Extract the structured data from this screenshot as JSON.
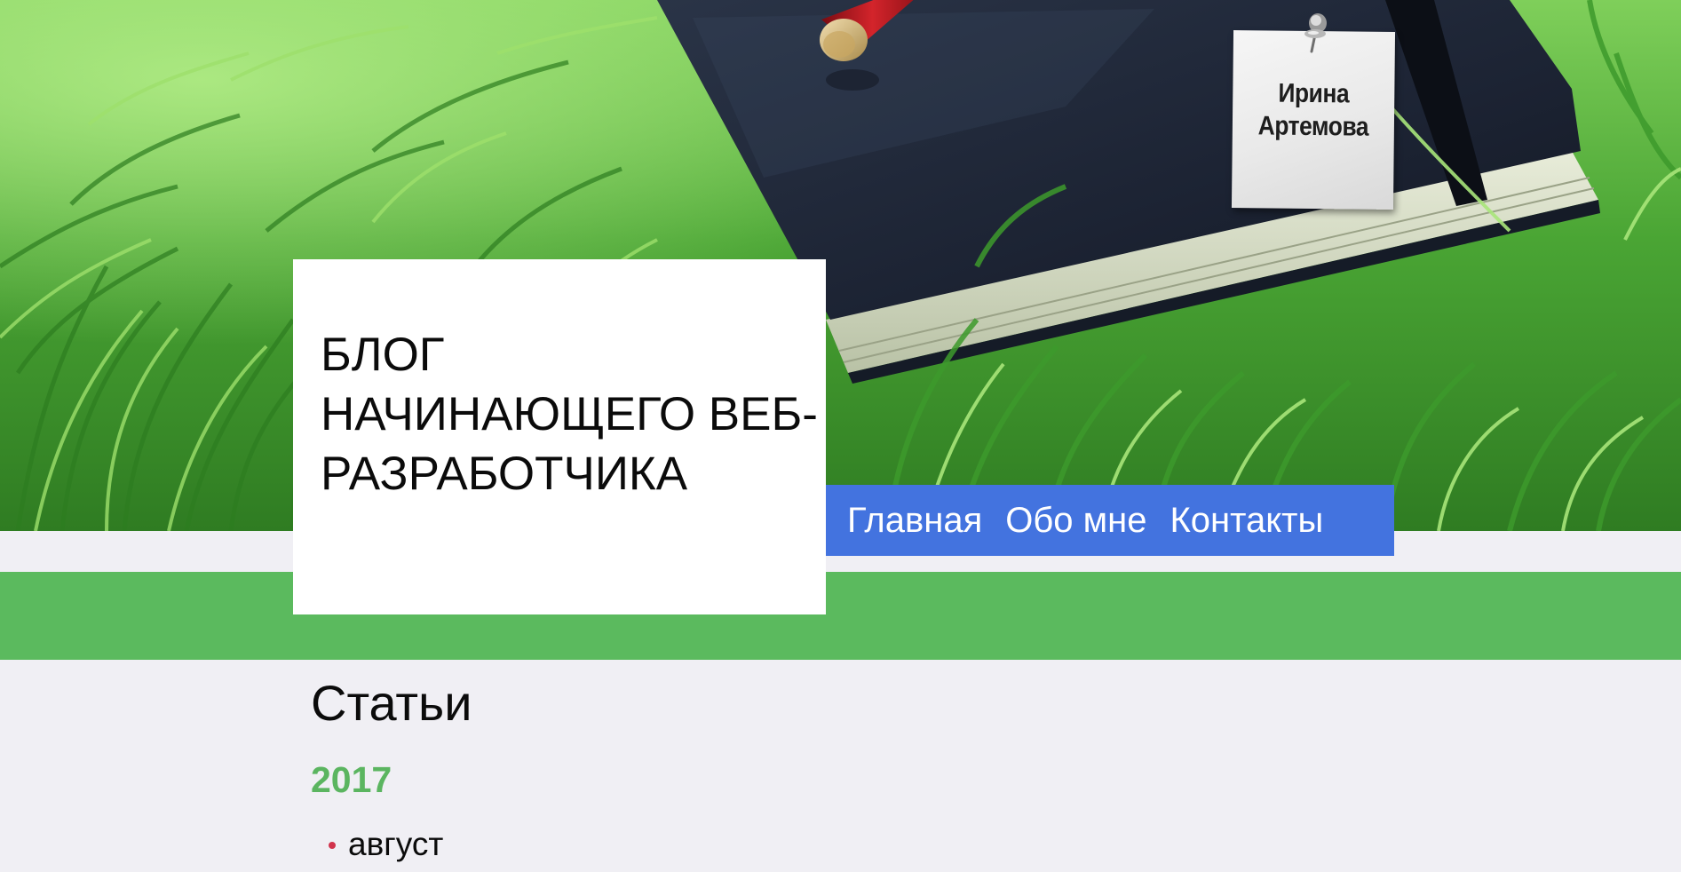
{
  "header": {
    "note_author": "Ирина Артемова",
    "site_title": "БЛОГ НАЧИНАЮЩЕГО ВЕБ-РАЗРАБОТЧИКА"
  },
  "nav": {
    "items": [
      {
        "label": "Главная"
      },
      {
        "label": "Обо мне"
      },
      {
        "label": "Контакты"
      }
    ]
  },
  "main": {
    "section_title": "Статьи",
    "archive": [
      {
        "year": "2017",
        "months": [
          {
            "label": "август"
          }
        ]
      }
    ]
  },
  "colors": {
    "page_background": "#f0eff4",
    "green_band": "#5bba5e",
    "nav_background": "#4373df",
    "year_accent": "#5bb560",
    "bullet_accent": "#d1334c"
  },
  "icons": {
    "pin": "push-pin-icon",
    "bullet": "bullet-icon"
  }
}
